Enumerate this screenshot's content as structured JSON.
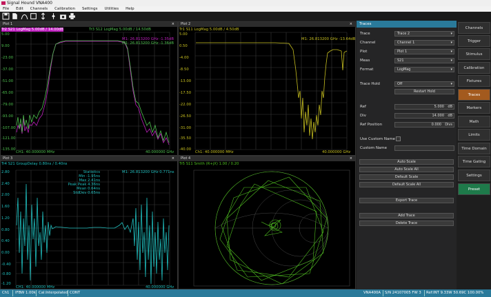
{
  "window": {
    "title": "Signal Hound VNA400"
  },
  "menu": [
    "File",
    "Edit",
    "Channels",
    "Calibration",
    "Settings",
    "Utilities",
    "Help"
  ],
  "toolbar": {
    "icons": [
      "save-icon",
      "document-icon",
      "curve-icon",
      "square-icon",
      "marker-icon",
      "move-icon",
      "camera-icon",
      "print-icon"
    ]
  },
  "plots": [
    {
      "header": "Plot 1",
      "trace_label": "Tr2 S21  LogMag  5.00dB / 14.00dB",
      "trace_label2": "Tr3 S12  LogMag  5.00dB / 14.50dB",
      "markers": [
        "M1: 26.813200 GHz  -1.35dB",
        "M1: 26.813200 GHz  -1.36dB"
      ],
      "yticks": [
        "5.00",
        "9.00",
        "-23.00",
        "-37.00",
        "-51.00",
        "-65.00",
        "-79.00",
        "-93.00",
        "-107.00",
        "-121.00",
        "-135.00"
      ],
      "start": "CH1: 40.000000 MHz",
      "stop": "40.000000 GHz",
      "colors": {
        "tr2": "#c020c0",
        "tr3": "#4fc04f"
      }
    },
    {
      "header": "Plot 2",
      "trace_label": "Tr1 S11  LogMag  5.00dB / 4.50dB",
      "markers": [
        "M1: 26.813200 GHz  -13.64dB"
      ],
      "yticks": [
        "5.00",
        "0.50",
        "-4.00",
        "-8.50",
        "-13.00",
        "-17.50",
        "-22.00",
        "-26.50",
        "-31.00",
        "-35.50",
        "-40.00"
      ],
      "start": "Ch1: 40.000000 MHz",
      "stop": "40.000000 GHz",
      "colors": {
        "tr1": "#c8c020"
      }
    },
    {
      "header": "Plot 3",
      "trace_label": "Tr4 S21  GroupDelay  0.80ns / 0.40ns",
      "markers": [
        "M1: 26.813200 GHz  0.771ns"
      ],
      "stats": [
        "Statistics",
        "Min -1.95ns",
        "Max 2.41ns",
        "Peak Peak 4.36ns",
        "Mean 0.64ns",
        "StdDev 0.65ns"
      ],
      "yticks": [
        "2.80",
        "2.40",
        "2.00",
        "1.60",
        "1.20",
        "0.80",
        "0.40",
        "0.00",
        "-0.40",
        "-0.80",
        "-1.20"
      ],
      "start": "CH1: 40.000000 MHz",
      "stop": "40.000000 GHz",
      "colors": {
        "tr4": "#20c0c0"
      }
    },
    {
      "header": "Plot 4",
      "trace_label": "Tr5 S11  Smith (R+jX)  1.00 / 0.20",
      "colors": {
        "tr5": "#50c020"
      }
    }
  ],
  "traces_panel": {
    "title": "Traces",
    "fields": [
      {
        "label": "Trace",
        "value": "Trace 2"
      },
      {
        "label": "Channel",
        "value": "Channel 1"
      },
      {
        "label": "Plot",
        "value": "Plot 1"
      },
      {
        "label": "Meas",
        "value": "S21"
      },
      {
        "label": "Format",
        "value": "LogMag"
      }
    ],
    "trace_hold": {
      "label": "Trace Hold",
      "value": "Off"
    },
    "restart_hold": "Restart Hold",
    "ref": {
      "label": "Ref",
      "value": "5.000",
      "unit": "dB"
    },
    "div": {
      "label": "Div",
      "value": "14.000",
      "unit": "dB"
    },
    "ref_position": {
      "label": "Ref Position",
      "value": "0.000",
      "unit": "Divs"
    },
    "use_custom_name": "Use Custom Name",
    "custom_name": "Custom Name",
    "buttons": [
      "Auto Scale",
      "Auto Scale All",
      "Default Scale",
      "Default Scale All"
    ],
    "export": "Export Trace",
    "add": "Add Trace",
    "delete": "Delete Trace"
  },
  "sidebar": [
    "Channels",
    "Trigger",
    "Stimulus",
    "Calibration",
    "Fixtures",
    "Traces",
    "Markers",
    "Math",
    "Limits",
    "Time Domain",
    "Time Gating",
    "Settings",
    "Preset"
  ],
  "status": {
    "ch": "Ch1",
    "ifbw": "IFBW 1.00k",
    "cal": "Cal:Interpolated",
    "cont": "CONT",
    "model": "VNA400A",
    "serial": "S/N 24107005  FW 3",
    "ref": "Ref:INT  9.33W  50.69C  100.00%"
  }
}
